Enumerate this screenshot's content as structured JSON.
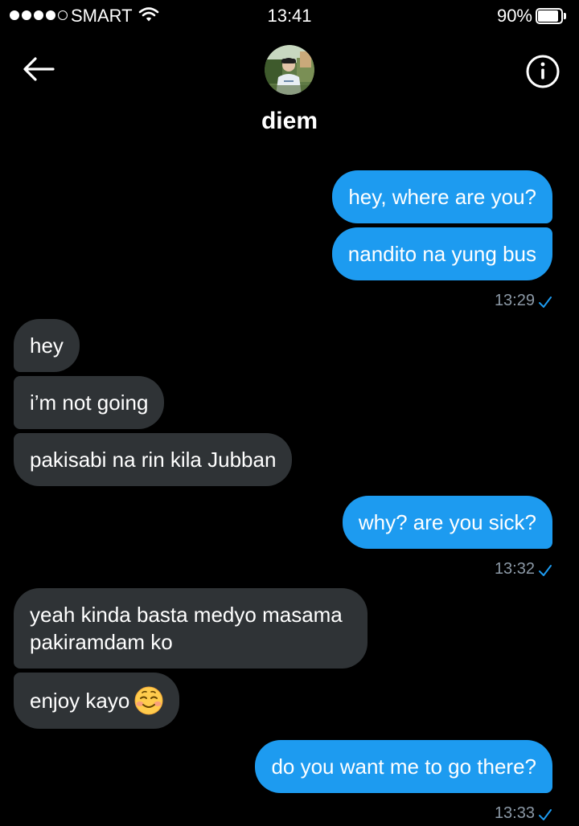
{
  "status_bar": {
    "carrier": "SMART",
    "time": "13:41",
    "battery_percent": "90%",
    "battery_level": 0.9,
    "signal_bars_filled": 4,
    "signal_bars_total": 5,
    "icons": [
      "wifi-icon",
      "battery-icon"
    ]
  },
  "header": {
    "contact_name": "diem",
    "back_icon": "arrow-left-icon",
    "info_icon": "info-circle-icon"
  },
  "messages": [
    {
      "direction": "out",
      "bubbles": [
        "hey, where are you?",
        "nandito na yung bus"
      ],
      "time": "13:29",
      "status_icon": "check-icon"
    },
    {
      "direction": "in",
      "bubbles": [
        "hey",
        "i’m not going",
        "pakisabi na rin kila Jubban"
      ]
    },
    {
      "direction": "out",
      "bubbles": [
        "why? are you sick?"
      ],
      "time": "13:32",
      "status_icon": "check-icon"
    },
    {
      "direction": "in",
      "bubbles": [
        "yeah kinda basta medyo masama pakiramdam ko",
        "enjoy kayo"
      ],
      "emoji_icon": "smiling-face-icon"
    },
    {
      "direction": "out",
      "bubbles": [
        "do you want me to go there?"
      ],
      "time": "13:33",
      "status_icon": "check-icon"
    }
  ],
  "colors": {
    "background": "#000000",
    "outgoing_bubble": "#1d9bf0",
    "incoming_bubble": "#2f3336",
    "timestamp": "#8b98a5",
    "check": "#1d9bf0"
  }
}
